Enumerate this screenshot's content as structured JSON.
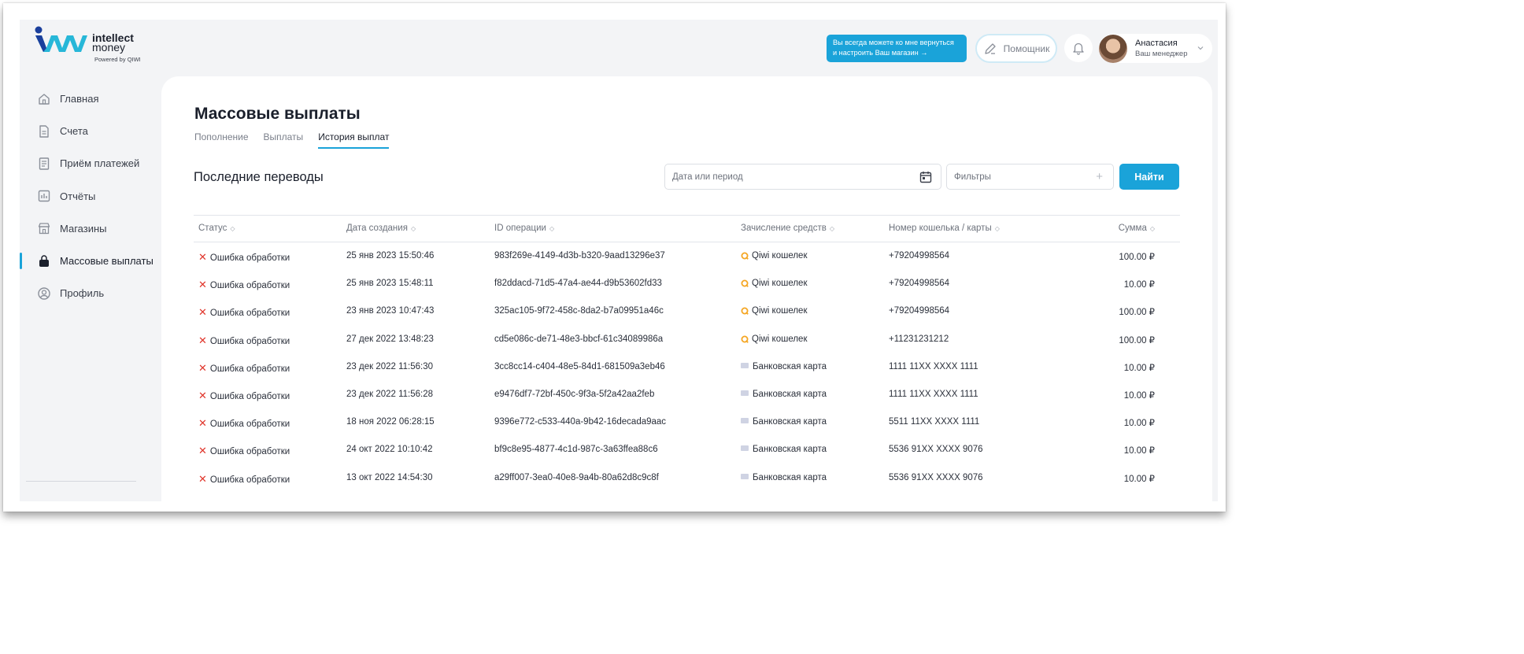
{
  "brand": {
    "name_line1": "intellect",
    "name_line2": "money",
    "powered_by": "Powered by QIWI"
  },
  "sidebar": {
    "items": [
      {
        "label": "Главная",
        "icon": "home-icon"
      },
      {
        "label": "Счета",
        "icon": "document-icon"
      },
      {
        "label": "Приём платежей",
        "icon": "receipt-icon"
      },
      {
        "label": "Отчёты",
        "icon": "chart-icon"
      },
      {
        "label": "Магазины",
        "icon": "store-icon"
      },
      {
        "label": "Массовые выплаты",
        "icon": "bag-icon",
        "active": true
      },
      {
        "label": "Профиль",
        "icon": "user-icon"
      }
    ]
  },
  "header": {
    "help_line1": "Вы всегда можете ко мне вернуться",
    "help_line2": "и настроить Ваш магазин →",
    "assistant_label": "Помощник",
    "user_name": "Анастасия",
    "user_role": "Ваш менеджер"
  },
  "main": {
    "title": "Массовые выплаты",
    "tabs": [
      "Пополнение",
      "Выплаты",
      "История выплат"
    ],
    "active_tab": 2,
    "section_title": "Последние переводы",
    "date_placeholder": "Дата или период",
    "filters_label": "Фильтры",
    "find_label": "Найти"
  },
  "table": {
    "headers": {
      "status": "Статус",
      "date": "Дата создания",
      "id": "ID операции",
      "method": "Зачисление средств",
      "wallet": "Номер кошелька / карты",
      "sum": "Сумма"
    },
    "rows": [
      {
        "status": "Ошибка обработки",
        "date": "25 янв 2023 15:50:46",
        "id": "983f269e-4149-4d3b-b320-9aad13296e37",
        "method": "Qiwi кошелек",
        "method_type": "qiwi",
        "wallet": "+79204998564",
        "sum": "100.00 ₽"
      },
      {
        "status": "Ошибка обработки",
        "date": "25 янв 2023 15:48:11",
        "id": "f82ddacd-71d5-47a4-ae44-d9b53602fd33",
        "method": "Qiwi кошелек",
        "method_type": "qiwi",
        "wallet": "+79204998564",
        "sum": "10.00 ₽"
      },
      {
        "status": "Ошибка обработки",
        "date": "23 янв 2023 10:47:43",
        "id": "325ac105-9f72-458c-8da2-b7a09951a46c",
        "method": "Qiwi кошелек",
        "method_type": "qiwi",
        "wallet": "+79204998564",
        "sum": "100.00 ₽"
      },
      {
        "status": "Ошибка обработки",
        "date": "27 дек 2022 13:48:23",
        "id": "cd5e086c-de71-48e3-bbcf-61c34089986a",
        "method": "Qiwi кошелек",
        "method_type": "qiwi",
        "wallet": "+11231231212",
        "sum": "100.00 ₽"
      },
      {
        "status": "Ошибка обработки",
        "date": "23 дек 2022 11:56:30",
        "id": "3cc8cc14-c404-48e5-84d1-681509a3eb46",
        "method": "Банковская карта",
        "method_type": "card",
        "wallet": "1111 11XX XXXX 1111",
        "sum": "10.00 ₽"
      },
      {
        "status": "Ошибка обработки",
        "date": "23 дек 2022 11:56:28",
        "id": "e9476df7-72bf-450c-9f3a-5f2a42aa2feb",
        "method": "Банковская карта",
        "method_type": "card",
        "wallet": "1111 11XX XXXX 1111",
        "sum": "10.00 ₽"
      },
      {
        "status": "Ошибка обработки",
        "date": "18 ноя 2022 06:28:15",
        "id": "9396e772-c533-440a-9b42-16decada9aac",
        "method": "Банковская карта",
        "method_type": "card",
        "wallet": "5511 11XX XXXX 1111",
        "sum": "10.00 ₽"
      },
      {
        "status": "Ошибка обработки",
        "date": "24 окт 2022 10:10:42",
        "id": "bf9c8e95-4877-4c1d-987c-3a63ffea88c6",
        "method": "Банковская карта",
        "method_type": "card",
        "wallet": "5536 91XX XXXX 9076",
        "sum": "10.00 ₽"
      },
      {
        "status": "Ошибка обработки",
        "date": "13 окт 2022 14:54:30",
        "id": "a29ff007-3ea0-40e8-9a4b-80a62d8c9c8f",
        "method": "Банковская карта",
        "method_type": "card",
        "wallet": "5536 91XX XXXX 9076",
        "sum": "10.00 ₽"
      }
    ]
  },
  "colors": {
    "accent": "#1aa3d9",
    "error": "#e0352b",
    "qiwi": "#f5a623",
    "background": "#f3f4f6"
  }
}
